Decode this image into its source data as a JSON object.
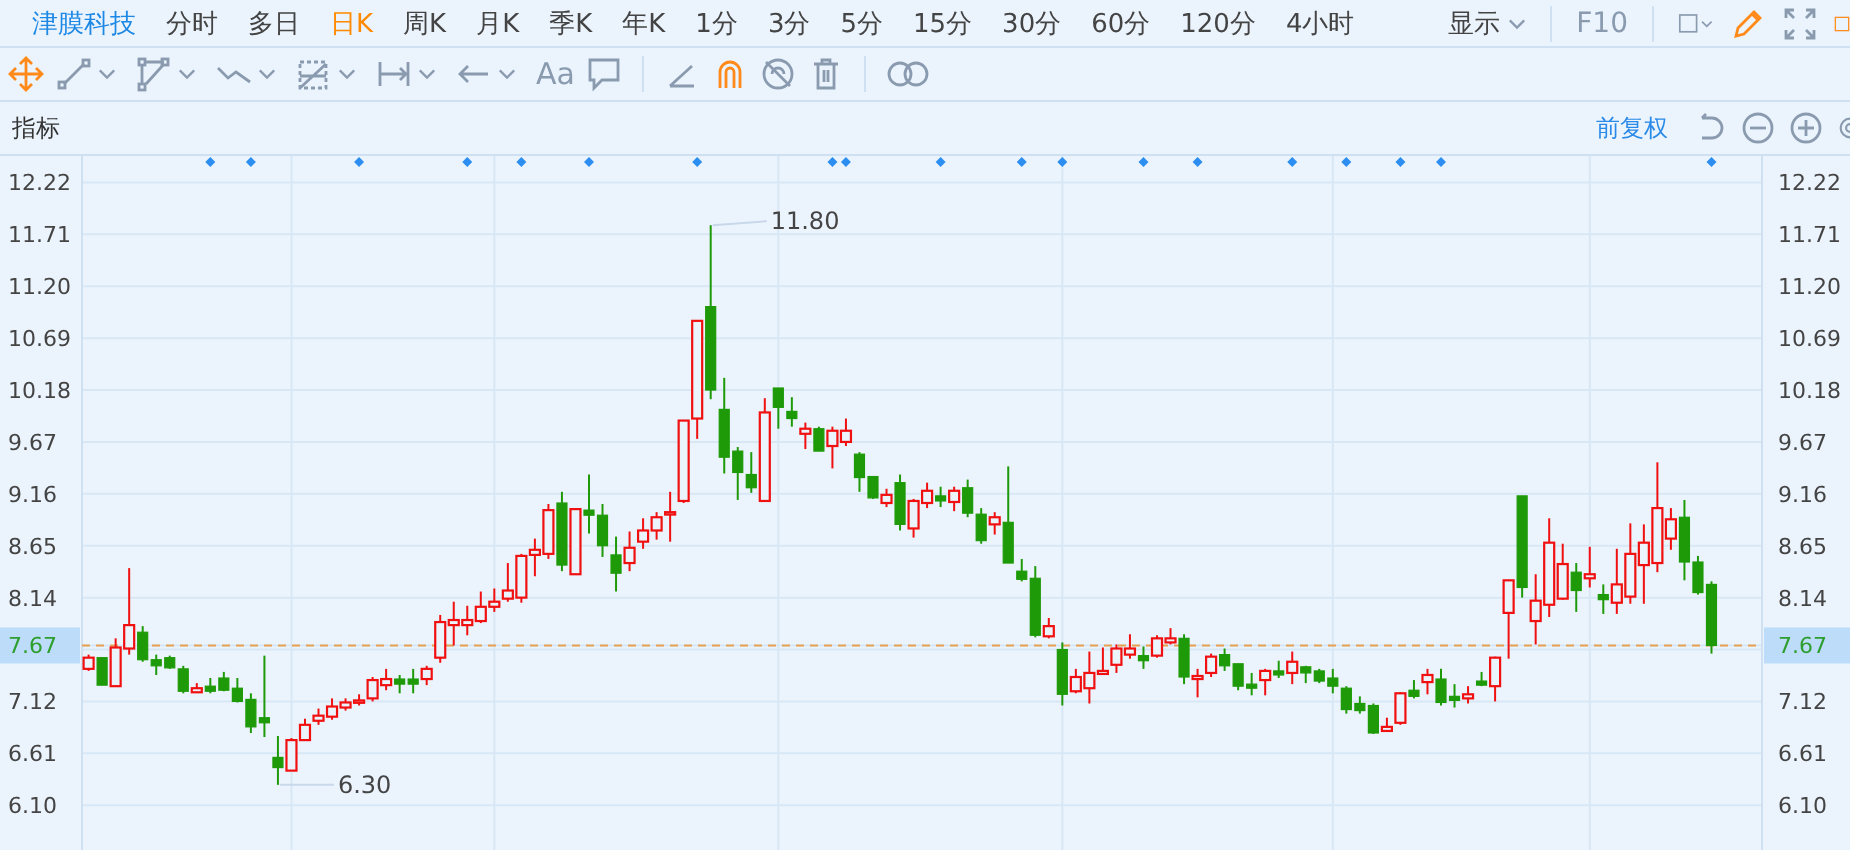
{
  "header": {
    "stock_name": "津膜科技",
    "tabs": [
      {
        "label": "分时",
        "selected": false
      },
      {
        "label": "多日",
        "selected": false
      },
      {
        "label": "日K",
        "selected": true
      },
      {
        "label": "周K",
        "selected": false
      },
      {
        "label": "月K",
        "selected": false
      },
      {
        "label": "季K",
        "selected": false
      },
      {
        "label": "年K",
        "selected": false
      },
      {
        "label": "1分",
        "selected": false
      },
      {
        "label": "3分",
        "selected": false
      },
      {
        "label": "5分",
        "selected": false
      },
      {
        "label": "15分",
        "selected": false
      },
      {
        "label": "30分",
        "selected": false
      },
      {
        "label": "60分",
        "selected": false
      },
      {
        "label": "120分",
        "selected": false
      },
      {
        "label": "4小时",
        "selected": false
      }
    ],
    "display_menu": "显示",
    "f10": "F10",
    "right_tools": [
      {
        "kind": "pencil",
        "active": true
      },
      {
        "kind": "fullscreen",
        "active": false
      },
      {
        "kind": "square",
        "active": true
      }
    ]
  },
  "drawing_tools": [
    {
      "kind": "move",
      "active": true
    },
    {
      "kind": "segment",
      "active": false,
      "menu": true
    },
    {
      "kind": "polygon",
      "active": false,
      "menu": true
    },
    {
      "kind": "wave",
      "active": false,
      "menu": true
    },
    {
      "kind": "box",
      "active": false,
      "menu": true
    },
    {
      "kind": "measure",
      "active": false,
      "menu": true
    },
    {
      "kind": "arrow",
      "active": false,
      "menu": true
    },
    {
      "kind": "text",
      "label": "Aa",
      "active": false
    },
    {
      "kind": "comment",
      "active": false
    },
    {
      "kind": "separator"
    },
    {
      "kind": "angle",
      "active": false
    },
    {
      "kind": "magnet",
      "active": true
    },
    {
      "kind": "hide",
      "active": false
    },
    {
      "kind": "delete",
      "active": false
    },
    {
      "kind": "separator"
    },
    {
      "kind": "link",
      "active": false
    }
  ],
  "indicator_bar": {
    "label": "指标",
    "adjust": "前复权"
  },
  "chart": {
    "chart_data": {
      "type": "candlestick",
      "ylim": [
        5.66,
        12.48
      ],
      "y2lim": [
        5.66,
        12.48
      ],
      "grid": true,
      "yticks": [
        {
          "value": 12.22,
          "label": "12.22"
        },
        {
          "value": 11.71,
          "label": "11.71"
        },
        {
          "value": 11.2,
          "label": "11.20"
        },
        {
          "value": 10.69,
          "label": "10.69"
        },
        {
          "value": 10.18,
          "label": "10.18"
        },
        {
          "value": 9.67,
          "label": "9.67"
        },
        {
          "value": 9.16,
          "label": "9.16"
        },
        {
          "value": 8.65,
          "label": "8.65"
        },
        {
          "value": 8.14,
          "label": "8.14"
        },
        {
          "value": 7.67,
          "label": "7.67"
        },
        {
          "value": 7.12,
          "label": "7.12"
        },
        {
          "value": 6.61,
          "label": "6.61"
        },
        {
          "value": 6.1,
          "label": "6.10"
        }
      ],
      "y2ticks": [
        {
          "value": 12.22,
          "label": "12.22"
        },
        {
          "value": 11.71,
          "label": "11.71"
        },
        {
          "value": 11.2,
          "label": "11.20"
        },
        {
          "value": 10.69,
          "label": "10.69"
        },
        {
          "value": 10.18,
          "label": "10.18"
        },
        {
          "value": 9.67,
          "label": "9.67"
        },
        {
          "value": 9.16,
          "label": "9.16"
        },
        {
          "value": 8.65,
          "label": "8.65"
        },
        {
          "value": 8.14,
          "label": "8.14"
        },
        {
          "value": 7.67,
          "label": "7.67"
        },
        {
          "value": 7.12,
          "label": "7.12"
        },
        {
          "value": 6.61,
          "label": "6.61"
        },
        {
          "value": 6.1,
          "label": "6.10"
        }
      ],
      "ohlc": [
        [
          7.44,
          7.58,
          7.42,
          7.55
        ],
        [
          7.55,
          7.55,
          7.28,
          7.28
        ],
        [
          7.27,
          7.74,
          7.27,
          7.65
        ],
        [
          7.64,
          8.43,
          7.58,
          7.87
        ],
        [
          7.8,
          7.86,
          7.51,
          7.53
        ],
        [
          7.53,
          7.58,
          7.38,
          7.47
        ],
        [
          7.55,
          7.57,
          7.44,
          7.45
        ],
        [
          7.44,
          7.47,
          7.2,
          7.22
        ],
        [
          7.21,
          7.3,
          7.21,
          7.25
        ],
        [
          7.27,
          7.35,
          7.2,
          7.22
        ],
        [
          7.35,
          7.41,
          7.22,
          7.23
        ],
        [
          7.25,
          7.35,
          7.11,
          7.12
        ],
        [
          7.14,
          7.2,
          6.81,
          6.87
        ],
        [
          6.96,
          7.57,
          6.77,
          6.91
        ],
        [
          6.57,
          6.78,
          6.3,
          6.47
        ],
        [
          6.44,
          6.76,
          6.44,
          6.74
        ],
        [
          6.74,
          6.95,
          6.74,
          6.89
        ],
        [
          6.93,
          7.05,
          6.89,
          6.98
        ],
        [
          6.97,
          7.15,
          6.94,
          7.07
        ],
        [
          7.06,
          7.15,
          7.03,
          7.11
        ],
        [
          7.12,
          7.19,
          7.08,
          7.13
        ],
        [
          7.15,
          7.36,
          7.12,
          7.33
        ],
        [
          7.28,
          7.44,
          7.23,
          7.34
        ],
        [
          7.34,
          7.38,
          7.2,
          7.29
        ],
        [
          7.34,
          7.44,
          7.2,
          7.29
        ],
        [
          7.34,
          7.47,
          7.28,
          7.44
        ],
        [
          7.55,
          7.97,
          7.5,
          7.9
        ],
        [
          7.87,
          8.1,
          7.67,
          7.92
        ],
        [
          7.87,
          8.06,
          7.77,
          7.92
        ],
        [
          7.91,
          8.2,
          7.89,
          8.05
        ],
        [
          8.05,
          8.23,
          8.0,
          8.1
        ],
        [
          8.13,
          8.48,
          8.1,
          8.21
        ],
        [
          8.14,
          8.57,
          8.09,
          8.55
        ],
        [
          8.56,
          8.72,
          8.35,
          8.61
        ],
        [
          8.57,
          9.06,
          8.52,
          9.0
        ],
        [
          9.07,
          9.18,
          8.4,
          8.46
        ],
        [
          8.37,
          9.02,
          8.37,
          9.01
        ],
        [
          9.0,
          9.35,
          8.77,
          8.95
        ],
        [
          8.95,
          9.06,
          8.54,
          8.65
        ],
        [
          8.56,
          8.74,
          8.2,
          8.38
        ],
        [
          8.48,
          8.79,
          8.4,
          8.63
        ],
        [
          8.69,
          8.92,
          8.62,
          8.8
        ],
        [
          8.8,
          8.98,
          8.71,
          8.93
        ],
        [
          8.97,
          9.18,
          8.69,
          8.98
        ],
        [
          9.09,
          9.88,
          9.07,
          9.88
        ],
        [
          9.9,
          10.86,
          9.7,
          10.86
        ],
        [
          11.0,
          11.8,
          10.09,
          10.18
        ],
        [
          9.99,
          10.3,
          9.36,
          9.52
        ],
        [
          9.58,
          9.62,
          9.1,
          9.37
        ],
        [
          9.35,
          9.57,
          9.17,
          9.22
        ],
        [
          9.09,
          10.1,
          9.09,
          9.96
        ],
        [
          10.2,
          10.2,
          9.8,
          10.01
        ],
        [
          9.97,
          10.11,
          9.82,
          9.9
        ],
        [
          9.75,
          9.86,
          9.6,
          9.8
        ],
        [
          9.8,
          9.82,
          9.58,
          9.58
        ],
        [
          9.63,
          9.82,
          9.41,
          9.78
        ],
        [
          9.67,
          9.9,
          9.63,
          9.78
        ],
        [
          9.55,
          9.57,
          9.18,
          9.32
        ],
        [
          9.33,
          9.33,
          9.11,
          9.12
        ],
        [
          9.07,
          9.21,
          9.03,
          9.15
        ],
        [
          9.27,
          9.35,
          8.8,
          8.86
        ],
        [
          8.82,
          9.11,
          8.73,
          9.09
        ],
        [
          9.07,
          9.27,
          9.02,
          9.19
        ],
        [
          9.14,
          9.23,
          9.03,
          9.09
        ],
        [
          9.08,
          9.23,
          8.99,
          9.19
        ],
        [
          9.22,
          9.3,
          8.93,
          8.97
        ],
        [
          8.96,
          9.02,
          8.67,
          8.7
        ],
        [
          8.86,
          8.98,
          8.76,
          8.93
        ],
        [
          8.88,
          9.43,
          8.48,
          8.48
        ],
        [
          8.4,
          8.52,
          8.3,
          8.32
        ],
        [
          8.33,
          8.45,
          7.75,
          7.77
        ],
        [
          7.76,
          7.94,
          7.74,
          7.86
        ],
        [
          7.63,
          7.7,
          7.08,
          7.19
        ],
        [
          7.22,
          7.44,
          7.2,
          7.36
        ],
        [
          7.25,
          7.61,
          7.1,
          7.4
        ],
        [
          7.39,
          7.65,
          7.38,
          7.42
        ],
        [
          7.48,
          7.68,
          7.4,
          7.64
        ],
        [
          7.58,
          7.78,
          7.54,
          7.64
        ],
        [
          7.57,
          7.66,
          7.44,
          7.52
        ],
        [
          7.57,
          7.77,
          7.55,
          7.74
        ],
        [
          7.7,
          7.84,
          7.68,
          7.74
        ],
        [
          7.74,
          7.78,
          7.29,
          7.36
        ],
        [
          7.34,
          7.44,
          7.16,
          7.37
        ],
        [
          7.4,
          7.59,
          7.36,
          7.56
        ],
        [
          7.58,
          7.64,
          7.42,
          7.47
        ],
        [
          7.49,
          7.49,
          7.23,
          7.27
        ],
        [
          7.29,
          7.4,
          7.18,
          7.25
        ],
        [
          7.33,
          7.44,
          7.18,
          7.42
        ],
        [
          7.42,
          7.52,
          7.35,
          7.38
        ],
        [
          7.4,
          7.61,
          7.29,
          7.51
        ],
        [
          7.46,
          7.47,
          7.3,
          7.4
        ],
        [
          7.42,
          7.44,
          7.3,
          7.32
        ],
        [
          7.35,
          7.44,
          7.2,
          7.27
        ],
        [
          7.25,
          7.27,
          7.0,
          7.04
        ],
        [
          7.1,
          7.17,
          7.0,
          7.03
        ],
        [
          7.08,
          7.1,
          6.8,
          6.81
        ],
        [
          6.83,
          6.96,
          6.83,
          6.87
        ],
        [
          6.91,
          7.21,
          6.89,
          7.2
        ],
        [
          7.23,
          7.33,
          7.15,
          7.17
        ],
        [
          7.31,
          7.44,
          7.19,
          7.38
        ],
        [
          7.34,
          7.44,
          7.08,
          7.11
        ],
        [
          7.17,
          7.29,
          7.06,
          7.13
        ],
        [
          7.15,
          7.27,
          7.1,
          7.19
        ],
        [
          7.32,
          7.41,
          7.27,
          7.28
        ],
        [
          7.27,
          7.56,
          7.12,
          7.55
        ],
        [
          7.99,
          8.31,
          7.54,
          8.31
        ],
        [
          9.14,
          9.14,
          8.14,
          8.24
        ],
        [
          7.91,
          8.37,
          7.68,
          8.11
        ],
        [
          8.07,
          8.92,
          7.95,
          8.68
        ],
        [
          8.13,
          8.67,
          8.12,
          8.47
        ],
        [
          8.39,
          8.48,
          8.0,
          8.21
        ],
        [
          8.33,
          8.64,
          8.24,
          8.37
        ],
        [
          8.17,
          8.27,
          7.98,
          8.12
        ],
        [
          8.09,
          8.62,
          7.98,
          8.27
        ],
        [
          8.15,
          8.87,
          8.08,
          8.57
        ],
        [
          8.46,
          8.86,
          8.08,
          8.68
        ],
        [
          8.48,
          9.47,
          8.39,
          9.02
        ],
        [
          8.72,
          9.02,
          8.61,
          8.91
        ],
        [
          8.93,
          9.1,
          8.31,
          8.49
        ],
        [
          8.49,
          8.55,
          8.17,
          8.19
        ],
        [
          8.27,
          8.3,
          7.59,
          7.67
        ]
      ],
      "annotations": [
        "11.80",
        "6.30"
      ],
      "ref_lines": [
        {
          "axis": "y",
          "value": 7.67
        }
      ]
    }
  }
}
